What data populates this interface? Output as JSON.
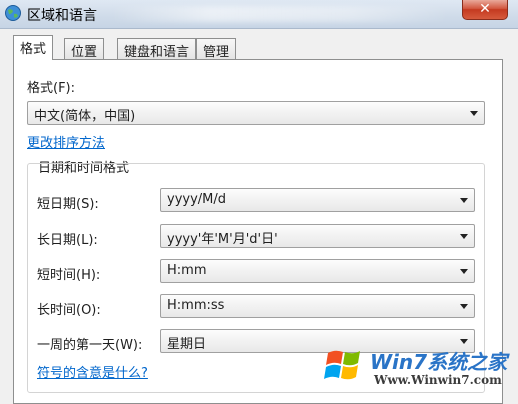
{
  "window": {
    "title": "区域和语言",
    "close_glyph": "✕"
  },
  "tabs": [
    {
      "label": "格式"
    },
    {
      "label": "位置"
    },
    {
      "label": "键盘和语言"
    },
    {
      "label": "管理"
    }
  ],
  "format_panel": {
    "format_label": "格式(F):",
    "format_value": "中文(简体，中国)",
    "change_sort_link": "更改排序方法",
    "group_title": "日期和时间格式",
    "fields": [
      {
        "label": "短日期(S):",
        "value": "yyyy/M/d"
      },
      {
        "label": "长日期(L):",
        "value": "yyyy'年'M'月'd'日'"
      },
      {
        "label": "短时间(H):",
        "value": "H:mm"
      },
      {
        "label": "长时间(O):",
        "value": "H:mm:ss"
      },
      {
        "label": "一周的第一天(W):",
        "value": "星期日"
      }
    ],
    "symbols_link": "符号的含意是什么?"
  },
  "watermark": {
    "brand_text": "Win7系统之家",
    "url_text": "Www.Winwin7.com",
    "icon": "windows-flag-logo"
  },
  "icons": {
    "app": "globe-icon",
    "dropdown": "chevron-down-icon"
  },
  "colors": {
    "link": "#0066cc",
    "close_button": "#c43a20",
    "logo_blue": "#2a74c7"
  }
}
